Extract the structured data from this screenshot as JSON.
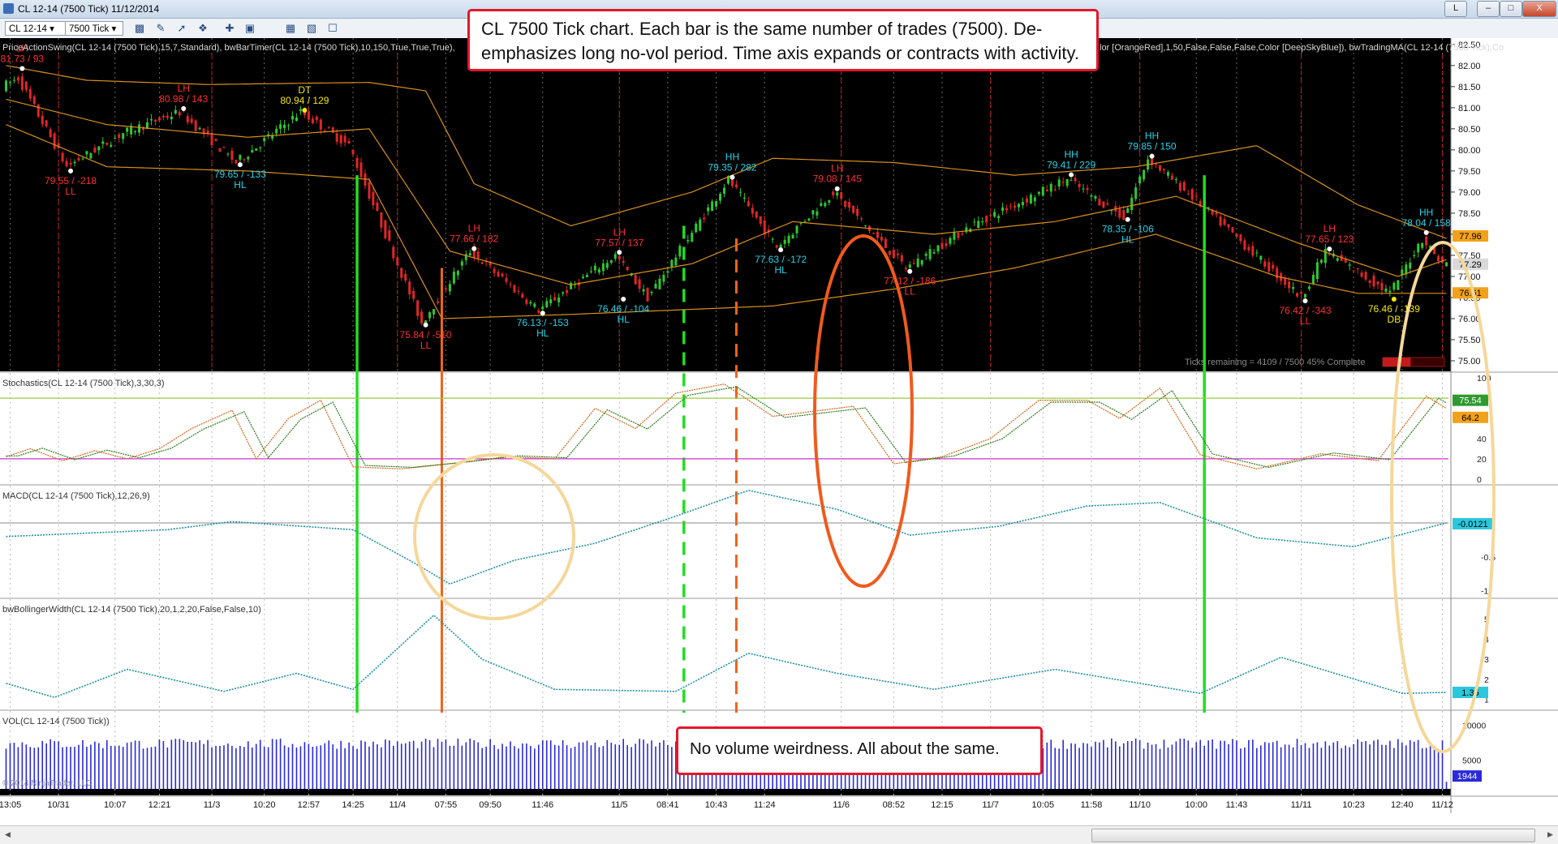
{
  "window": {
    "title": "CL 12-14 (7500 Tick)  11/12/2014",
    "min_label": "L",
    "restore_label": "–",
    "max_label": "□",
    "close_label": "X"
  },
  "toolbar": {
    "instrument": "CL 12-14",
    "period": "7500 Tick"
  },
  "callouts": {
    "top": "CL 7500 Tick chart. Each bar is the same number of trades (7500). De-emphasizes long no-vol period. Time axis expands or contracts with activity.",
    "volume": "No volume weirdness. All about the same."
  },
  "colors": {
    "price_bg": "#000000",
    "up_candle": "#2fc830",
    "down_candle": "#e12626",
    "bollinger": "#d9901c",
    "swing_high_label": "#ff3030",
    "swing_low_label": "#26d3e8",
    "double_label": "#f5e60e",
    "stoch_k": "#d0681c",
    "stoch_d": "#2a7a1a",
    "macd": "#1e8fa0",
    "bbwidth": "#1e8fa0",
    "volume": "#2a2ad8",
    "green_marker": "#22dd22",
    "orange_marker": "#f06418"
  },
  "chart_data": [
    {
      "type": "candlestick",
      "panel": "price",
      "indicator_header": "PriceActionSwing(CL 12-14 (7500 Tick),15,7,Standard), bwBarTimer(CL 12-14 (7500 Tick),10,150,True,True,True),",
      "indicator_header_right": "lor [OrangeRed],1,50,False,False,False,Color [DeepSkyBlue]), bwTradingMA(CL 12-14 (7500 Tick),Co",
      "ylim": [
        74.75,
        82.65
      ],
      "yticks": [
        "82.50",
        "82.00",
        "81.50",
        "81.00",
        "80.50",
        "80.00",
        "79.50",
        "79.00",
        "78.50",
        "78.00",
        "77.50",
        "77.00",
        "76.50",
        "76.00",
        "75.50",
        "75.00"
      ],
      "price_labels": {
        "upper": "77.96",
        "current": "77.29",
        "lower": "76.61"
      },
      "bar_timer": "Ticks remaining = 4109 / 7500   45% Complete",
      "price_path": [
        {
          "bar": 0,
          "price": 81.5
        },
        {
          "bar": 4,
          "price": 81.7
        },
        {
          "bar": 16,
          "price": 79.6
        },
        {
          "bar": 30,
          "price": 80.4
        },
        {
          "bar": 44,
          "price": 80.9
        },
        {
          "bar": 58,
          "price": 79.7
        },
        {
          "bar": 74,
          "price": 80.9
        },
        {
          "bar": 86,
          "price": 80.1
        },
        {
          "bar": 104,
          "price": 75.9
        },
        {
          "bar": 116,
          "price": 77.6
        },
        {
          "bar": 133,
          "price": 76.2
        },
        {
          "bar": 152,
          "price": 77.5
        },
        {
          "bar": 160,
          "price": 76.5
        },
        {
          "bar": 180,
          "price": 79.3
        },
        {
          "bar": 192,
          "price": 77.7
        },
        {
          "bar": 206,
          "price": 79.0
        },
        {
          "bar": 224,
          "price": 77.2
        },
        {
          "bar": 240,
          "price": 78.2
        },
        {
          "bar": 264,
          "price": 79.3
        },
        {
          "bar": 278,
          "price": 78.4
        },
        {
          "bar": 284,
          "price": 79.8
        },
        {
          "bar": 296,
          "price": 78.8
        },
        {
          "bar": 322,
          "price": 76.5
        },
        {
          "bar": 328,
          "price": 77.6
        },
        {
          "bar": 344,
          "price": 76.6
        },
        {
          "bar": 352,
          "price": 77.9
        },
        {
          "bar": 357,
          "price": 77.3
        }
      ],
      "bollinger_upper": [
        {
          "bar": 0,
          "price": 82.0
        },
        {
          "bar": 20,
          "price": 81.65
        },
        {
          "bar": 50,
          "price": 81.55
        },
        {
          "bar": 90,
          "price": 81.6
        },
        {
          "bar": 104,
          "price": 81.4
        },
        {
          "bar": 116,
          "price": 79.2
        },
        {
          "bar": 140,
          "price": 78.2
        },
        {
          "bar": 170,
          "price": 79.0
        },
        {
          "bar": 190,
          "price": 79.8
        },
        {
          "bar": 220,
          "price": 79.7
        },
        {
          "bar": 250,
          "price": 79.4
        },
        {
          "bar": 280,
          "price": 79.6
        },
        {
          "bar": 310,
          "price": 80.1
        },
        {
          "bar": 335,
          "price": 78.7
        },
        {
          "bar": 357,
          "price": 77.9
        }
      ],
      "bollinger_middle": [
        {
          "bar": 0,
          "price": 81.2
        },
        {
          "bar": 25,
          "price": 80.6
        },
        {
          "bar": 60,
          "price": 80.3
        },
        {
          "bar": 90,
          "price": 80.5
        },
        {
          "bar": 110,
          "price": 77.6
        },
        {
          "bar": 140,
          "price": 76.8
        },
        {
          "bar": 170,
          "price": 77.3
        },
        {
          "bar": 195,
          "price": 78.3
        },
        {
          "bar": 230,
          "price": 78.0
        },
        {
          "bar": 260,
          "price": 78.3
        },
        {
          "bar": 290,
          "price": 78.9
        },
        {
          "bar": 320,
          "price": 77.8
        },
        {
          "bar": 345,
          "price": 77.0
        },
        {
          "bar": 357,
          "price": 77.4
        }
      ],
      "bollinger_lower": [
        {
          "bar": 0,
          "price": 80.6
        },
        {
          "bar": 25,
          "price": 79.6
        },
        {
          "bar": 60,
          "price": 79.5
        },
        {
          "bar": 90,
          "price": 79.3
        },
        {
          "bar": 108,
          "price": 76.0
        },
        {
          "bar": 140,
          "price": 76.1
        },
        {
          "bar": 165,
          "price": 76.2
        },
        {
          "bar": 190,
          "price": 76.3
        },
        {
          "bar": 220,
          "price": 76.7
        },
        {
          "bar": 250,
          "price": 77.2
        },
        {
          "bar": 285,
          "price": 78.0
        },
        {
          "bar": 315,
          "price": 77.0
        },
        {
          "bar": 335,
          "price": 76.6
        },
        {
          "bar": 357,
          "price": 76.6
        }
      ],
      "swing_labels": [
        {
          "bar": 4,
          "price": 81.93,
          "lines": [
            "LH",
            "81.73 / 93"
          ],
          "kind": "high"
        },
        {
          "bar": 16,
          "price": 79.5,
          "lines": [
            "79.55 / -218",
            "LL"
          ],
          "kind": "low"
        },
        {
          "bar": 44,
          "price": 80.98,
          "lines": [
            "LH",
            "80.98 / 143"
          ],
          "kind": "high"
        },
        {
          "bar": 58,
          "price": 79.65,
          "lines": [
            "79.65 / -133",
            "HL"
          ],
          "kind": "low"
        },
        {
          "bar": 74,
          "price": 80.94,
          "lines": [
            "DT",
            "80.94 / 129"
          ],
          "kind": "double"
        },
        {
          "bar": 104,
          "price": 75.85,
          "lines": [
            "75.84 / -510",
            "LL"
          ],
          "kind": "low"
        },
        {
          "bar": 116,
          "price": 77.66,
          "lines": [
            "LH",
            "77.66 / 182"
          ],
          "kind": "high"
        },
        {
          "bar": 133,
          "price": 76.13,
          "lines": [
            "76.13 / -153",
            "HL"
          ],
          "kind": "low"
        },
        {
          "bar": 152,
          "price": 77.57,
          "lines": [
            "LH",
            "77.57 / 137"
          ],
          "kind": "high"
        },
        {
          "bar": 153,
          "price": 76.46,
          "lines": [
            "76.46 / -104",
            "HL"
          ],
          "kind": "low"
        },
        {
          "bar": 180,
          "price": 79.35,
          "lines": [
            "HH",
            "79.35 / 282"
          ],
          "kind": "high_up"
        },
        {
          "bar": 192,
          "price": 77.63,
          "lines": [
            "77.63 / -172",
            "HL"
          ],
          "kind": "low"
        },
        {
          "bar": 206,
          "price": 79.08,
          "lines": [
            "LH",
            "79.08 / 145"
          ],
          "kind": "high"
        },
        {
          "bar": 224,
          "price": 77.12,
          "lines": [
            "77.12 / -186",
            "LL"
          ],
          "kind": "low"
        },
        {
          "bar": 264,
          "price": 79.41,
          "lines": [
            "HH",
            "79.41 / 229"
          ],
          "kind": "high_up"
        },
        {
          "bar": 278,
          "price": 78.35,
          "lines": [
            "78.35 / -106",
            "HL"
          ],
          "kind": "low"
        },
        {
          "bar": 284,
          "price": 79.85,
          "lines": [
            "HH",
            "79.85 / 150"
          ],
          "kind": "high_up"
        },
        {
          "bar": 322,
          "price": 76.42,
          "lines": [
            "76.42 / -343",
            "LL"
          ],
          "kind": "low"
        },
        {
          "bar": 328,
          "price": 77.65,
          "lines": [
            "LH",
            "77.65 / 123"
          ],
          "kind": "high"
        },
        {
          "bar": 344,
          "price": 76.46,
          "lines": [
            "76.46 / -139",
            "DB"
          ],
          "kind": "double_low"
        },
        {
          "bar": 352,
          "price": 78.04,
          "lines": [
            "HH",
            "78.04 / 158"
          ],
          "kind": "high_up"
        }
      ]
    },
    {
      "type": "line",
      "panel": "stochastics",
      "header": "Stochastics(CL 12-14 (7500 Tick),3,30,3)",
      "ylim": [
        -5,
        105
      ],
      "yticks": [
        "100",
        "80",
        "60",
        "40",
        "20",
        "0"
      ],
      "levels": [
        80,
        20
      ],
      "last_labels": {
        "k": "75.54",
        "d": "64.2"
      },
      "k_path": [
        {
          "bar": 0,
          "v": 22
        },
        {
          "bar": 6,
          "v": 30
        },
        {
          "bar": 14,
          "v": 18
        },
        {
          "bar": 22,
          "v": 28
        },
        {
          "bar": 30,
          "v": 20
        },
        {
          "bar": 38,
          "v": 30
        },
        {
          "bar": 46,
          "v": 50
        },
        {
          "bar": 56,
          "v": 68
        },
        {
          "bar": 62,
          "v": 20
        },
        {
          "bar": 70,
          "v": 60
        },
        {
          "bar": 78,
          "v": 78
        },
        {
          "bar": 86,
          "v": 12
        },
        {
          "bar": 98,
          "v": 10
        },
        {
          "bar": 112,
          "v": 16
        },
        {
          "bar": 124,
          "v": 22
        },
        {
          "bar": 136,
          "v": 20
        },
        {
          "bar": 146,
          "v": 70
        },
        {
          "bar": 156,
          "v": 50
        },
        {
          "bar": 166,
          "v": 85
        },
        {
          "bar": 178,
          "v": 94
        },
        {
          "bar": 190,
          "v": 62
        },
        {
          "bar": 210,
          "v": 72
        },
        {
          "bar": 220,
          "v": 15
        },
        {
          "bar": 232,
          "v": 22
        },
        {
          "bar": 244,
          "v": 40
        },
        {
          "bar": 256,
          "v": 78
        },
        {
          "bar": 268,
          "v": 78
        },
        {
          "bar": 276,
          "v": 60
        },
        {
          "bar": 286,
          "v": 90
        },
        {
          "bar": 296,
          "v": 24
        },
        {
          "bar": 310,
          "v": 10
        },
        {
          "bar": 326,
          "v": 25
        },
        {
          "bar": 340,
          "v": 18
        },
        {
          "bar": 352,
          "v": 82
        },
        {
          "bar": 357,
          "v": 70
        }
      ]
    },
    {
      "type": "line",
      "panel": "macd",
      "header": "MACD(CL 12-14 (7500 Tick),12,26,9)",
      "ylim": [
        -1.1,
        0.55
      ],
      "yticks": [
        "0",
        "-0.5",
        "-1"
      ],
      "zero_line": 0,
      "last_label": "-0.0121",
      "path": [
        {
          "bar": 0,
          "v": -0.2
        },
        {
          "bar": 20,
          "v": -0.15
        },
        {
          "bar": 40,
          "v": -0.1
        },
        {
          "bar": 56,
          "v": 0.02
        },
        {
          "bar": 86,
          "v": -0.1
        },
        {
          "bar": 100,
          "v": -0.55
        },
        {
          "bar": 110,
          "v": -0.9
        },
        {
          "bar": 126,
          "v": -0.55
        },
        {
          "bar": 146,
          "v": -0.3
        },
        {
          "bar": 166,
          "v": 0.1
        },
        {
          "bar": 184,
          "v": 0.48
        },
        {
          "bar": 206,
          "v": 0.2
        },
        {
          "bar": 224,
          "v": -0.18
        },
        {
          "bar": 246,
          "v": -0.05
        },
        {
          "bar": 268,
          "v": 0.25
        },
        {
          "bar": 286,
          "v": 0.3
        },
        {
          "bar": 310,
          "v": -0.22
        },
        {
          "bar": 334,
          "v": -0.35
        },
        {
          "bar": 357,
          "v": 0.0
        }
      ]
    },
    {
      "type": "line",
      "panel": "bollinger_width",
      "header": "bwBollingerWidth(CL 12-14 (7500 Tick),20,1,2,20,False,False,10)",
      "ylim": [
        0.5,
        6.0
      ],
      "yticks": [
        "5",
        "4",
        "3",
        "2",
        "1"
      ],
      "last_label": "1.35",
      "path": [
        {
          "bar": 0,
          "v": 1.8
        },
        {
          "bar": 12,
          "v": 1.1
        },
        {
          "bar": 30,
          "v": 2.5
        },
        {
          "bar": 54,
          "v": 1.4
        },
        {
          "bar": 72,
          "v": 2.3
        },
        {
          "bar": 86,
          "v": 1.5
        },
        {
          "bar": 106,
          "v": 5.2
        },
        {
          "bar": 118,
          "v": 3.0
        },
        {
          "bar": 136,
          "v": 1.5
        },
        {
          "bar": 166,
          "v": 1.4
        },
        {
          "bar": 184,
          "v": 3.3
        },
        {
          "bar": 206,
          "v": 2.3
        },
        {
          "bar": 230,
          "v": 1.5
        },
        {
          "bar": 260,
          "v": 2.5
        },
        {
          "bar": 296,
          "v": 1.3
        },
        {
          "bar": 316,
          "v": 3.1
        },
        {
          "bar": 346,
          "v": 1.3
        },
        {
          "bar": 357,
          "v": 1.35
        }
      ]
    },
    {
      "type": "bar",
      "panel": "volume",
      "header": "VOL(CL 12-14 (7500 Tick))",
      "ylim": [
        0,
        12000
      ],
      "yticks": [
        "10000",
        "5000"
      ],
      "typical_value": 7500,
      "last_label": "1944",
      "last_value": 1944,
      "watermark": "© 2014 NinjaTrader, LLC"
    }
  ],
  "x_axis": {
    "bars": 358,
    "ticks": [
      {
        "bar": 1,
        "label": "13:05"
      },
      {
        "bar": 13,
        "label": "10/31"
      },
      {
        "bar": 27,
        "label": "10:07"
      },
      {
        "bar": 38,
        "label": "12:21"
      },
      {
        "bar": 51,
        "label": "11/3"
      },
      {
        "bar": 64,
        "label": "10:20"
      },
      {
        "bar": 75,
        "label": "12:57"
      },
      {
        "bar": 86,
        "label": "14:25"
      },
      {
        "bar": 97,
        "label": "11/4"
      },
      {
        "bar": 109,
        "label": "07:55"
      },
      {
        "bar": 120,
        "label": "09:50"
      },
      {
        "bar": 133,
        "label": "11:46"
      },
      {
        "bar": 152,
        "label": "11/5"
      },
      {
        "bar": 164,
        "label": "08:41"
      },
      {
        "bar": 176,
        "label": "10:43"
      },
      {
        "bar": 188,
        "label": "11:24"
      },
      {
        "bar": 207,
        "label": "11/6"
      },
      {
        "bar": 220,
        "label": "08:52"
      },
      {
        "bar": 232,
        "label": "12:15"
      },
      {
        "bar": 244,
        "label": "11/7"
      },
      {
        "bar": 257,
        "label": "10:05"
      },
      {
        "bar": 269,
        "label": "11:58"
      },
      {
        "bar": 281,
        "label": "11/10"
      },
      {
        "bar": 295,
        "label": "10:00"
      },
      {
        "bar": 305,
        "label": "11:43"
      },
      {
        "bar": 321,
        "label": "11/11"
      },
      {
        "bar": 334,
        "label": "10:23"
      },
      {
        "bar": 346,
        "label": "12:40"
      },
      {
        "bar": 356,
        "label": "11/12"
      }
    ]
  },
  "session_lines_bars": [
    13,
    51,
    97,
    152,
    207,
    244,
    281,
    321,
    356
  ],
  "markers": {
    "green_solid_bars": [
      87,
      297
    ],
    "orange_solid_bars": [
      108
    ],
    "green_dashed_bars": [
      168
    ],
    "orange_dashed_bars": [
      181
    ]
  }
}
